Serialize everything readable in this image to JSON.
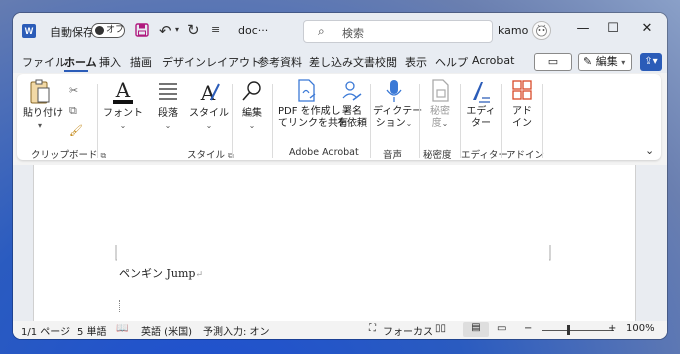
{
  "titlebar": {
    "autosave_label": "自動保存",
    "autosave_state": "オフ",
    "doc_name": "doc···",
    "search_placeholder": "検索",
    "user_name": "kamo"
  },
  "tabs": [
    "ファイル",
    "ホーム",
    "挿入",
    "描画",
    "デザイン",
    "レイアウト",
    "参考資料",
    "差し込み文書",
    "校閲",
    "表示",
    "ヘルプ",
    "Acrobat"
  ],
  "active_tab": "ホーム",
  "edit_mode_label": "編集",
  "ribbon": {
    "paste_label": "貼り付け",
    "clipboard_group": "クリップボード",
    "font_label": "フォント",
    "paragraph_label": "段落",
    "style_label": "スタイル",
    "style_group": "スタイル",
    "edit_label": "編集",
    "pdf_create_line1": "PDF を作成し",
    "pdf_create_line2": "てリンクを共有",
    "sign_line1": "署名",
    "sign_line2": "を依頼",
    "acrobat_group": "Adobe Acrobat",
    "dictate_line1": "ディクテー",
    "dictate_line2": "ション",
    "voice_group": "音声",
    "sensitivity_line1": "秘密",
    "sensitivity_line2": "度",
    "sensitivity_group": "秘密度",
    "editor_line1": "エディ",
    "editor_line2": "ター",
    "editor_group": "エディター",
    "addin_line1": "アド",
    "addin_line2": "イン",
    "addin_group": "アドイン"
  },
  "document": {
    "text": "ペンギン Jump"
  },
  "status": {
    "page": "1/1 ページ",
    "words": "5 単語",
    "language": "英語 (米国)",
    "predictive": "予測入力: オン",
    "focus": "フォーカス",
    "zoom": "100%"
  },
  "colors": {
    "accent": "#2b5cb8",
    "save_icon": "#b0197e",
    "pdf_icon": "#3b79d6",
    "editor_icon": "#2b5cb8",
    "addin_icon": "#d94a2a"
  }
}
